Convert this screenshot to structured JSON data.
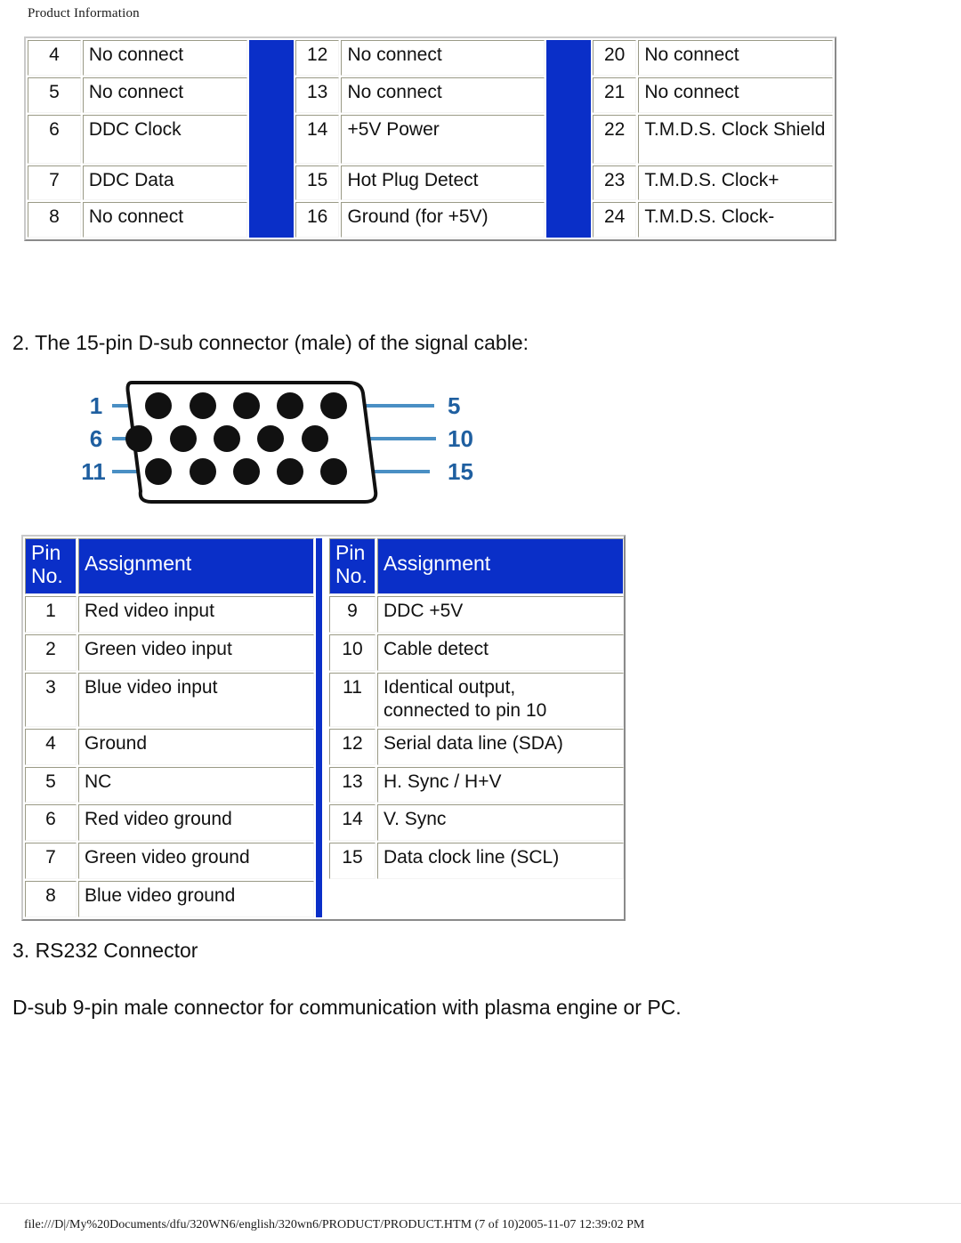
{
  "page": {
    "header": "Product Information",
    "footer": "file:///D|/My%20Documents/dfu/320WN6/english/320wn6/PRODUCT/PRODUCT.HTM (7 of 10)2005-11-07 12:39:02 PM"
  },
  "colors": {
    "accent_blue": "#0a2fc8",
    "header_text": "#ffffff",
    "body_text": "#111111",
    "diagram_label_blue": "#1f5fa0",
    "diagram_leader_blue": "#4a8fc4"
  },
  "dvi_table": {
    "columns": [
      {
        "rows": [
          {
            "pin": "4",
            "assignment": "No connect"
          },
          {
            "pin": "5",
            "assignment": "No connect"
          },
          {
            "pin": "6",
            "assignment": "DDC Clock"
          },
          {
            "pin": "7",
            "assignment": "DDC Data"
          },
          {
            "pin": "8",
            "assignment": "No connect"
          }
        ]
      },
      {
        "rows": [
          {
            "pin": "12",
            "assignment": "No connect"
          },
          {
            "pin": "13",
            "assignment": "No connect"
          },
          {
            "pin": "14",
            "assignment": "+5V Power"
          },
          {
            "pin": "15",
            "assignment": "Hot Plug Detect"
          },
          {
            "pin": "16",
            "assignment": "Ground (for +5V)"
          }
        ]
      },
      {
        "rows": [
          {
            "pin": "20",
            "assignment": "No connect"
          },
          {
            "pin": "21",
            "assignment": "No connect"
          },
          {
            "pin": "22",
            "assignment": "T.M.D.S. Clock Shield"
          },
          {
            "pin": "23",
            "assignment": "T.M.D.S. Clock+"
          },
          {
            "pin": "24",
            "assignment": "T.M.D.S. Clock-"
          }
        ]
      }
    ]
  },
  "sections": {
    "dsub_heading": "2. The 15-pin D-sub connector (male) of the signal cable:",
    "rs232_heading": "3. RS232 Connector",
    "rs232_text": "D-sub 9-pin male connector for communication with plasma engine or PC."
  },
  "dsub_figure": {
    "name": "15-pin D-sub male connector pinout diagram",
    "labels": [
      "1",
      "5",
      "6",
      "10",
      "11",
      "15"
    ],
    "rows": [
      5,
      5,
      5
    ]
  },
  "dsub_table": {
    "headers": {
      "pin_no_line1": "Pin",
      "pin_no_line2": "No.",
      "assignment": "Assignment"
    },
    "left": [
      {
        "pin": "1",
        "assignment": "Red video input"
      },
      {
        "pin": "2",
        "assignment": "Green video input"
      },
      {
        "pin": "3",
        "assignment": "Blue video input"
      },
      {
        "pin": "4",
        "assignment": "Ground"
      },
      {
        "pin": "5",
        "assignment": "NC"
      },
      {
        "pin": "6",
        "assignment": "Red video ground"
      },
      {
        "pin": "7",
        "assignment": "Green video ground"
      },
      {
        "pin": "8",
        "assignment": "Blue video ground"
      }
    ],
    "right": [
      {
        "pin": "9",
        "assignment": "DDC +5V"
      },
      {
        "pin": "10",
        "assignment": "Cable detect"
      },
      {
        "pin": "11",
        "assignment": "Identical output, connected to pin 10",
        "line1": "Identical output,",
        "line2": "connected to pin 10"
      },
      {
        "pin": "12",
        "assignment": "Serial data line (SDA)"
      },
      {
        "pin": "13",
        "assignment": "H. Sync / H+V"
      },
      {
        "pin": "14",
        "assignment": "V. Sync"
      },
      {
        "pin": "15",
        "assignment": "Data clock line (SCL)"
      },
      {
        "pin": "",
        "assignment": ""
      }
    ]
  }
}
